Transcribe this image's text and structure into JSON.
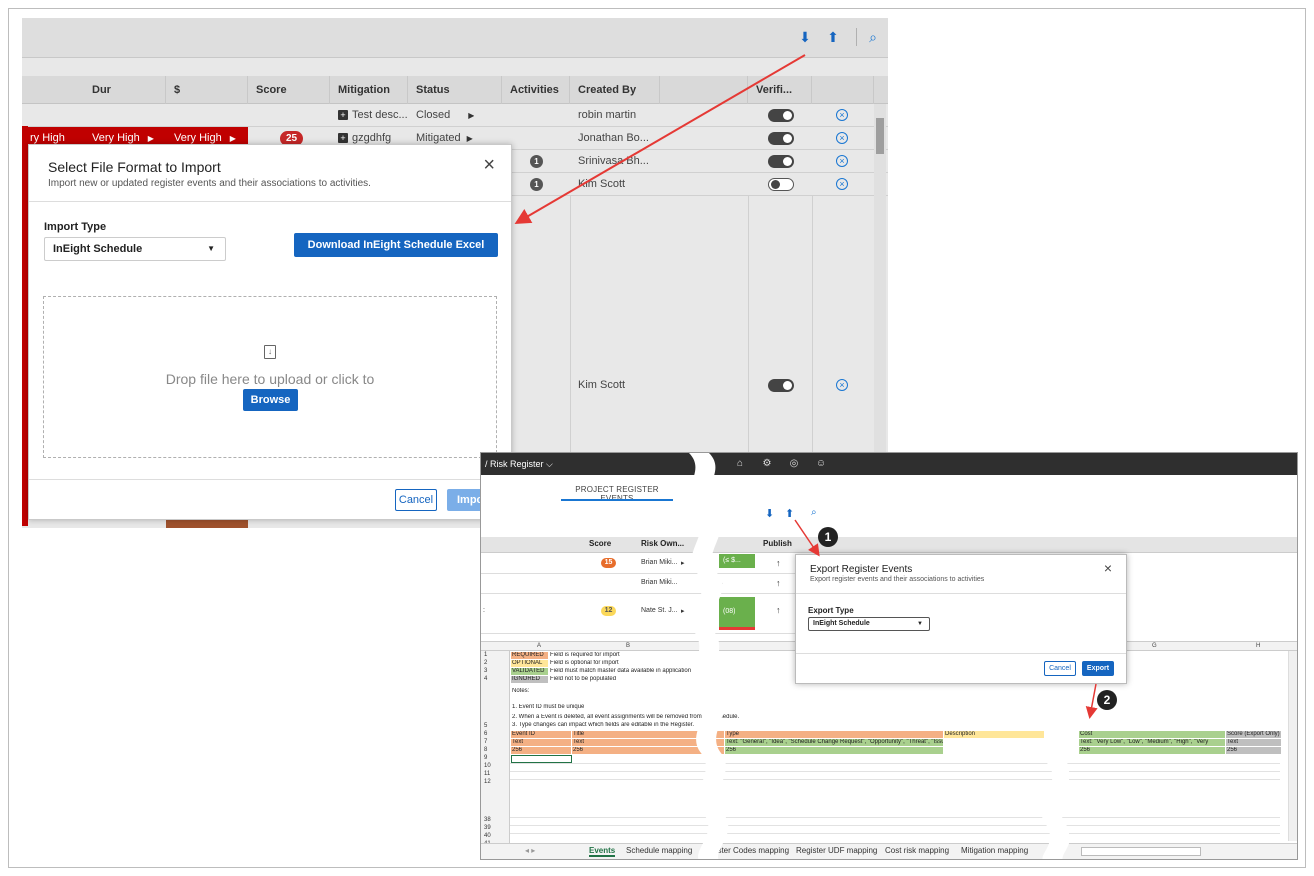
{
  "background_grid": {
    "columns": [
      "Dur",
      "$",
      "Score",
      "Mitigation",
      "Status",
      "Activities",
      "Created By",
      "Verifi..."
    ],
    "rows": [
      {
        "mitigation": "Test desc...",
        "status": "Closed",
        "created_by": "robin martin",
        "toggle": "on"
      },
      {
        "risk": "ry High",
        "dur": "Very High",
        "cost": "Very High",
        "score": "25",
        "mitigation": "gzgdhfg",
        "status": "Mitigated",
        "created_by": "Jonathan Bo...",
        "toggle": "on"
      },
      {
        "activities": "1",
        "created_by": "Srinivasa Bh...",
        "toggle": "on"
      },
      {
        "activities": "1",
        "created_by": "Kim Scott",
        "toggle": "off"
      },
      {
        "created_by": "Kim Scott",
        "toggle": "on"
      }
    ]
  },
  "import_dialog": {
    "title": "Select File Format to Import",
    "subtitle": "Import new or updated register events and their associations to activities.",
    "close": "×",
    "import_type_label": "Import Type",
    "import_type_value": "InEight Schedule",
    "download_button": "Download InEight Schedule Excel Template",
    "drop_text": "Drop file here to upload or click to",
    "browse_button": "Browse",
    "cancel_button": "Cancel",
    "import_button": "Impo"
  },
  "lower_screenshot": {
    "breadcrumb": "/ Risk Register ⌵",
    "tab": "PROJECT REGISTER EVENTS",
    "headers": [
      "Score",
      "Risk Own...",
      "Publish"
    ],
    "rows": [
      {
        "score": "15",
        "owner": "Brian Miki...",
        "green": "(≤ $...",
        "publish": "↑"
      },
      {
        "owner": "Brian Miki...",
        "publish": "↑"
      },
      {
        "score": "12",
        "owner": "Nate St. J...",
        "green": "(08)",
        "publish": "↑"
      }
    ],
    "left_mark": ":"
  },
  "excel": {
    "columns": [
      "A",
      "B",
      "G",
      "H"
    ],
    "legend": [
      {
        "row": "1",
        "tag": "REQUIRED",
        "text": "Field is required for import"
      },
      {
        "row": "2",
        "tag": "OPTIONAL",
        "text": "Field is optional for import"
      },
      {
        "row": "3",
        "tag": "VALIDATED",
        "text": "Field must match master data available in application"
      },
      {
        "row": "4",
        "tag": "IGNORED",
        "text": "Field not to be populated"
      }
    ],
    "notes_title": "Notes:",
    "notes": [
      "1. Event ID must be unique",
      "2. When a Event is deleted, all event assignments will be removed from the schedule.",
      "3.  Type changes can impact which fields are editable in the Register."
    ],
    "notes_row": "5",
    "header_row": {
      "num": "6",
      "cells": [
        "Event ID",
        "Title",
        "Type",
        "Description",
        "Cost",
        "Score (Export Only)"
      ]
    },
    "type_row": {
      "num": "7",
      "cells": [
        "Text",
        "Text",
        "Text: \"General\", \"Idea\", \"Schedule Change Request\", \"Opportunity\", \"Threat\", \"Issue\"",
        "",
        "Text: \"Very Low\", \"Low\", \"Medium\", \"High\", \"Very",
        "Text"
      ]
    },
    "len_row": {
      "num": "8",
      "cells": [
        "256",
        "256",
        "256",
        "",
        "256",
        "256"
      ]
    },
    "row_numbers": [
      "9",
      "10",
      "11",
      "12",
      "38",
      "39",
      "40",
      "41"
    ],
    "tabs": [
      "Events",
      "Schedule mapping",
      "Register Codes mapping",
      "Register UDF mapping",
      "Cost risk mapping",
      "Mitigation mapping"
    ]
  },
  "export_dialog": {
    "title": "Export Register Events",
    "subtitle": "Export register events and their associations to activities",
    "close": "×",
    "type_label": "Export Type",
    "type_value": "InEight Schedule",
    "cancel_button": "Cancel",
    "export_button": "Export"
  },
  "callouts": [
    "1",
    "2"
  ],
  "colors": {
    "accent": "#1565c0",
    "arrow": "#e53935",
    "danger": "#c00000"
  }
}
